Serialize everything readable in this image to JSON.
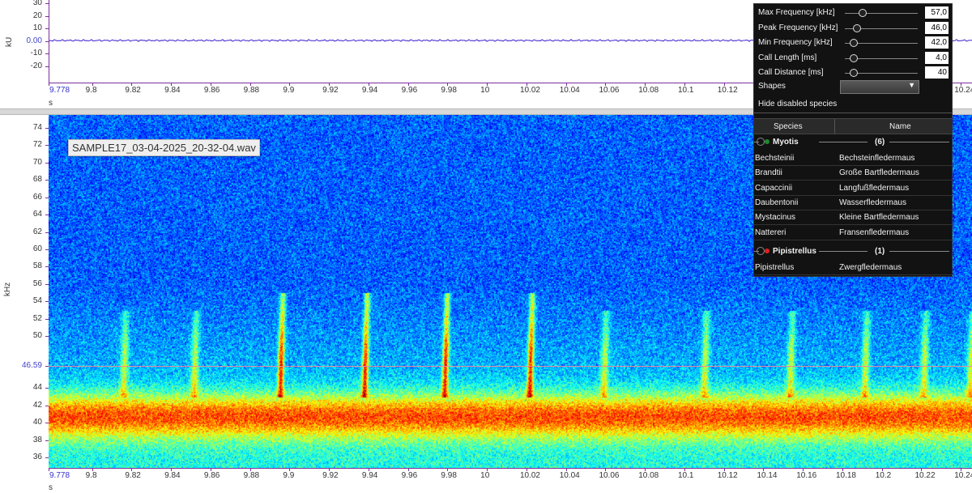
{
  "waveform": {
    "y_ticks": [
      "30",
      "20",
      "10",
      "0.00",
      "-10",
      "-20"
    ],
    "y_unit": "kU",
    "x_unit": "s"
  },
  "x_ticks": [
    "9.778",
    "9.8",
    "9.82",
    "9.84",
    "9.86",
    "9.88",
    "9.9",
    "9.92",
    "9.94",
    "9.96",
    "9.98",
    "10",
    "10.02",
    "10.04",
    "10.06",
    "10.08",
    "10.1",
    "10.12",
    "10.14",
    "10.16",
    "10.18",
    "10.2",
    "10.22",
    "10.24"
  ],
  "spectrogram": {
    "y_ticks": [
      "74",
      "72",
      "70",
      "68",
      "66",
      "64",
      "62",
      "60",
      "58",
      "56",
      "54",
      "52",
      "50",
      "46.59",
      "44",
      "42",
      "40",
      "38",
      "36"
    ],
    "y_unit": "kHz",
    "x_unit": "s",
    "file_label": "SAMPLE17_03-04-2025_20-32-04.wav",
    "cursor_frequency": "46.59",
    "colors": {
      "low": "#0a2fc8",
      "mid": "#10b8e8",
      "high": "#f0f020",
      "peak": "#e02010",
      "cursor": "#e88aa0"
    }
  },
  "panel": {
    "params": [
      {
        "label": "Max Frequency [kHz]",
        "value": "57,0",
        "level": 0.12
      },
      {
        "label": "Peak Frequency [kHz]",
        "value": "46,0",
        "level": 0.04
      },
      {
        "label": "Min Frequency [kHz]",
        "value": "42,0",
        "level": 0.0
      },
      {
        "label": "Call Length [ms]",
        "value": "4,0",
        "level": 0.0
      },
      {
        "label": "Call Distance [ms]",
        "value": "40",
        "level": 0.0
      }
    ],
    "shapes_label": "Shapes",
    "shapes_value": "",
    "hide_disabled_label": "Hide disabled species",
    "col_species": "Species",
    "col_name": "Name",
    "groups": [
      {
        "name": "Myotis",
        "count": "(6)",
        "dot_color": "#1c8c2c",
        "items": [
          {
            "species": "Bechsteinii",
            "name": "Bechsteinfledermaus"
          },
          {
            "species": "Brandtii",
            "name": "Große Bartfledermaus"
          },
          {
            "species": "Capaccinii",
            "name": "Langfußfledermaus"
          },
          {
            "species": "Daubentonii",
            "name": "Wasserfledermaus"
          },
          {
            "species": "Mystacinus",
            "name": "Kleine Bartfledermaus"
          },
          {
            "species": "Nattereri",
            "name": "Fransenfledermaus"
          }
        ]
      },
      {
        "name": "Pipistrellus",
        "count": "(1)",
        "dot_color": "#e02020",
        "items": [
          {
            "species": "Pipistrellus",
            "name": "Zwergfledermaus"
          }
        ]
      }
    ]
  }
}
